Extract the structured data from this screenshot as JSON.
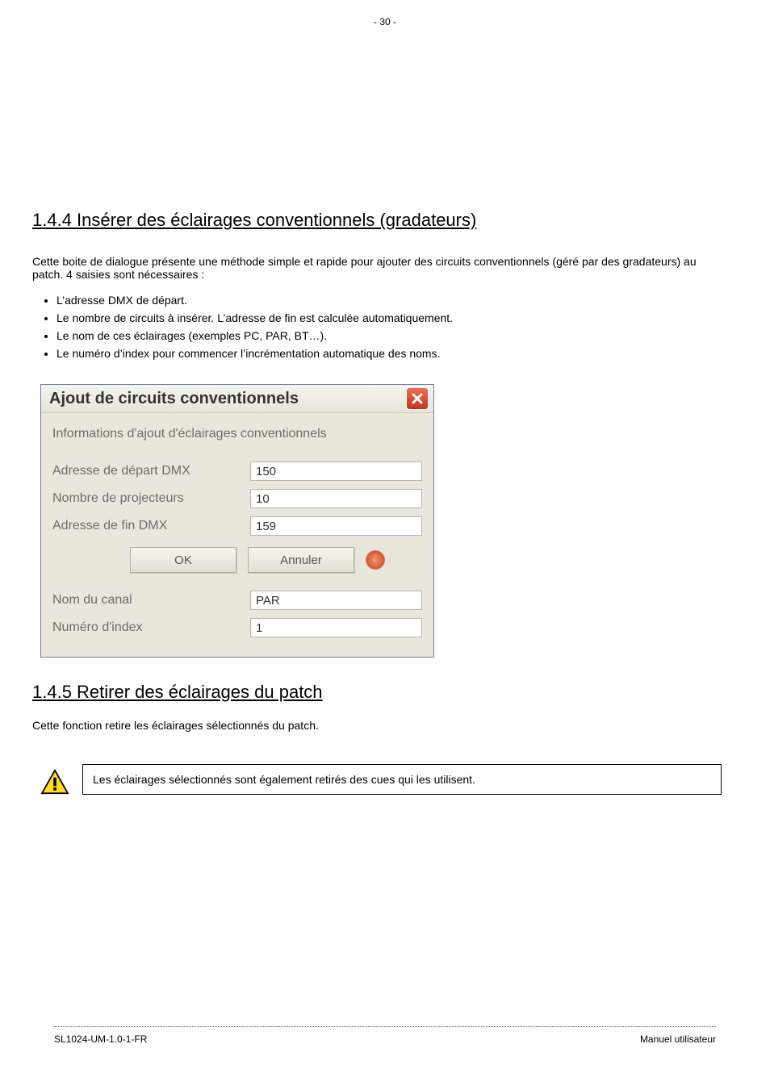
{
  "page_number": "- 30 -",
  "heading1": "1.4.4 Insérer des éclairages conventionnels (gradateurs)",
  "intro_para": "Cette boite de dialogue présente une méthode simple et rapide pour ajouter des circuits conventionnels (géré par des gradateurs) au patch. 4 saisies sont nécessaires :",
  "bullets": [
    "L’adresse DMX de départ.",
    "Le nombre de circuits à insérer. L’adresse de fin est calculée automatiquement.",
    "Le nom de ces éclairages (exemples PC, PAR, BT…).",
    "Le numéro d’index pour commencer l’incrémentation automatique des noms."
  ],
  "dialog": {
    "title": "Ajout de circuits conventionnels",
    "intro": "Informations d'ajout d'éclairages conventionnels",
    "labels": {
      "start": "Adresse de départ DMX",
      "count": "Nombre de projecteurs",
      "end": "Adresse de fin DMX",
      "name": "Nom du canal",
      "index": "Numéro d'index"
    },
    "values": {
      "start": "150",
      "count": "10",
      "end": "159",
      "name": "PAR",
      "index": "1"
    },
    "buttons": {
      "ok": "OK",
      "cancel": "Annuler"
    }
  },
  "heading2": "1.4.5 Retirer des éclairages du patch",
  "para2": "Cette fonction retire les éclairages sélectionnés du patch.",
  "notice": "Les éclairages sélectionnés sont également retirés des cues qui les utilisent.",
  "footer": {
    "left": "SL1024-UM-1.0-1-FR",
    "right": "Manuel utilisateur"
  }
}
